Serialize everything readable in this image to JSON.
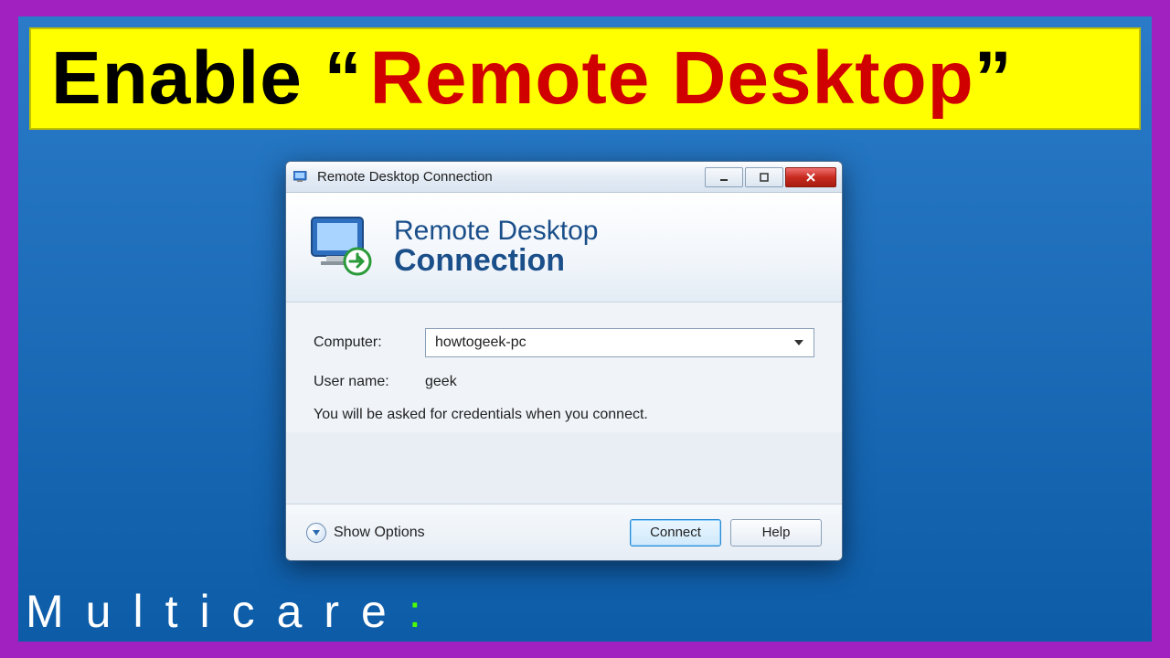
{
  "banner": {
    "part1": "Enable “",
    "part2": "Remote Desktop",
    "part3": "”"
  },
  "footer_brand": {
    "text": "Multicare",
    "suffix": ":"
  },
  "window": {
    "title": "Remote Desktop Connection",
    "header_line1": "Remote Desktop",
    "header_line2": "Connection",
    "labels": {
      "computer": "Computer:",
      "username": "User name:"
    },
    "values": {
      "computer": "howtogeek-pc",
      "username": "geek"
    },
    "info": "You will be asked for credentials when you connect.",
    "footer": {
      "show_options": "Show Options",
      "connect": "Connect",
      "help": "Help"
    }
  }
}
